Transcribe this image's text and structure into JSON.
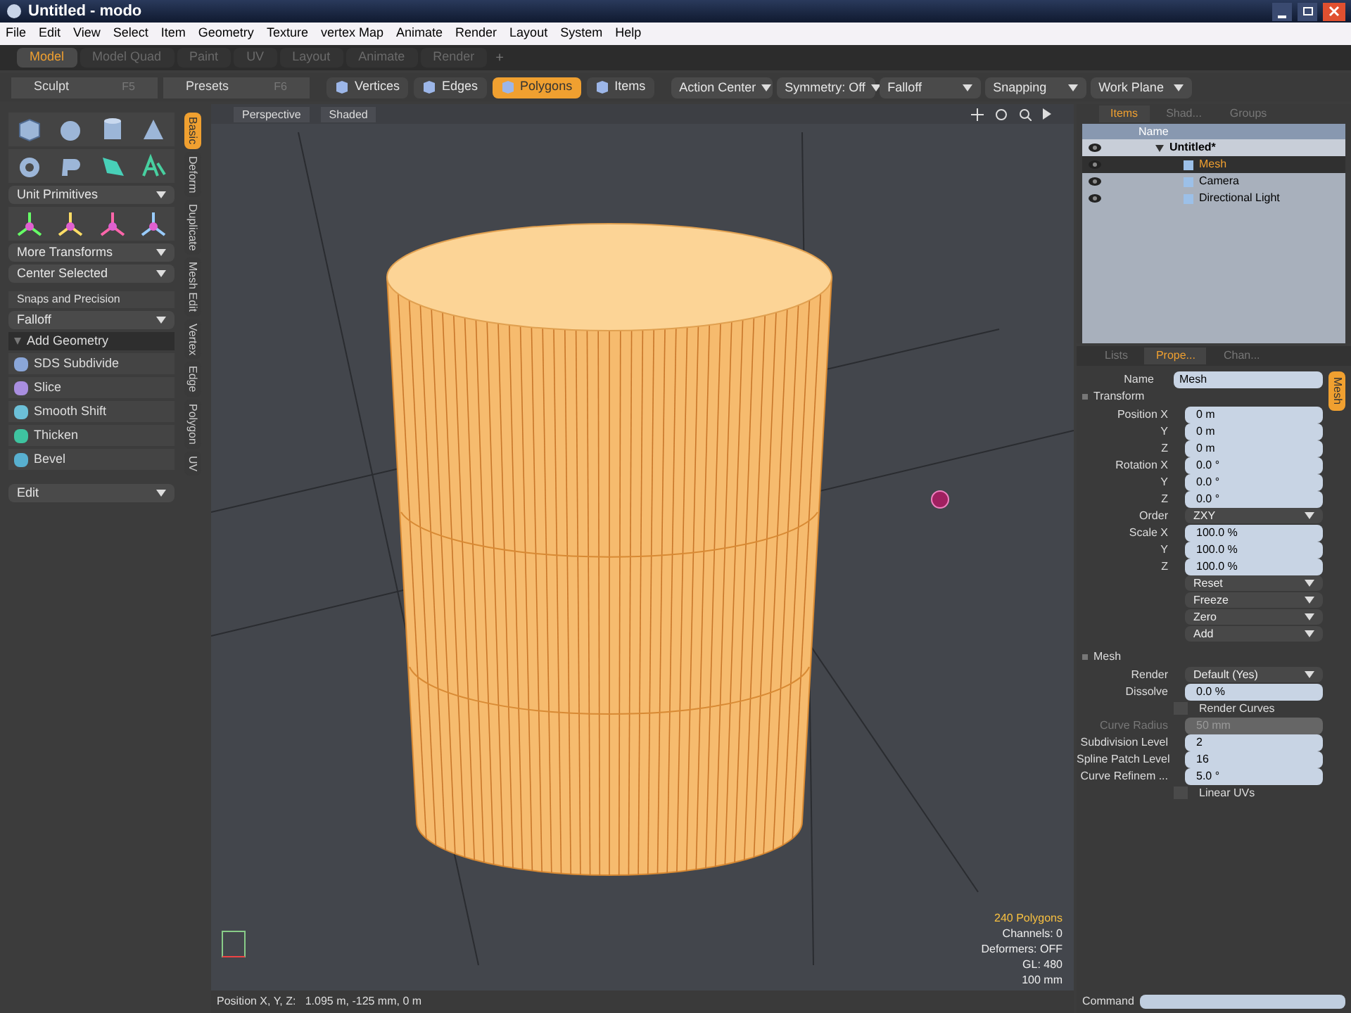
{
  "window": {
    "title": "Untitled - modo"
  },
  "menu": [
    "File",
    "Edit",
    "View",
    "Select",
    "Item",
    "Geometry",
    "Texture",
    "vertex Map",
    "Animate",
    "Render",
    "Layout",
    "System",
    "Help"
  ],
  "layout_tabs": [
    {
      "label": "Model",
      "selected": true
    },
    {
      "label": "Model Quad",
      "selected": false
    },
    {
      "label": "Paint",
      "selected": false
    },
    {
      "label": "UV",
      "selected": false
    },
    {
      "label": "Layout",
      "selected": false
    },
    {
      "label": "Animate",
      "selected": false
    },
    {
      "label": "Render",
      "selected": false
    }
  ],
  "layout_add": "+",
  "left_header": [
    {
      "label": "Sculpt",
      "shortcut": "F5"
    },
    {
      "label": "Presets",
      "shortcut": "F6"
    }
  ],
  "selection_modes": [
    {
      "label": "Vertices",
      "selected": false
    },
    {
      "label": "Edges",
      "selected": false
    },
    {
      "label": "Polygons",
      "selected": true
    },
    {
      "label": "Items",
      "selected": false
    }
  ],
  "toolbar_dropdowns": [
    "Action Center",
    "Symmetry: Off",
    "Falloff",
    "Snapping",
    "Work Plane"
  ],
  "toolbox": {
    "primitives_dropdown": "Unit Primitives",
    "transform_dropdowns": [
      "More Transforms",
      "Center Selected"
    ],
    "snaps_header": "Snaps and Precision",
    "falloff_dropdown": "Falloff",
    "add_geometry": {
      "label": "Add Geometry",
      "expanded": true
    },
    "tools": [
      {
        "label": "SDS Subdivide",
        "color": "#8aa6d8"
      },
      {
        "label": "Slice",
        "color": "#a98ee0"
      },
      {
        "label": "Smooth Shift",
        "color": "#6cc0d8"
      },
      {
        "label": "Thicken",
        "color": "#3ec4a0"
      },
      {
        "label": "Bevel",
        "color": "#58b0d0"
      }
    ],
    "edit_dropdown": "Edit"
  },
  "side_tabs": [
    {
      "label": "Basic",
      "selected": true
    },
    {
      "label": "Deform",
      "selected": false
    },
    {
      "label": "Duplicate",
      "selected": false
    },
    {
      "label": "Mesh Edit",
      "selected": false
    },
    {
      "label": "Vertex",
      "selected": false
    },
    {
      "label": "Edge",
      "selected": false
    },
    {
      "label": "Polygon",
      "selected": false
    },
    {
      "label": "UV",
      "selected": false
    }
  ],
  "viewport": {
    "tabs": [
      "Perspective",
      "Shaded"
    ],
    "stats": [
      {
        "text": "240 Polygons",
        "highlight": true
      },
      {
        "text": "Channels: 0",
        "highlight": false
      },
      {
        "text": "Deformers: OFF",
        "highlight": false
      },
      {
        "text": "GL: 480",
        "highlight": false
      },
      {
        "text": "100 mm",
        "highlight": false
      }
    ]
  },
  "status_bar": {
    "position": "Position X, Y, Z:   1.095 m, -125 mm, 0 m",
    "command_label": "Command"
  },
  "items_panel": {
    "tabs": [
      {
        "label": "Items",
        "selected": true
      },
      {
        "label": "Shad...",
        "selected": false
      },
      {
        "label": "Groups",
        "selected": false
      }
    ],
    "column": "Name",
    "tree": [
      {
        "label": "Untitled*",
        "expanded": true,
        "selected": false,
        "children": [
          {
            "label": "Mesh",
            "selected": true
          },
          {
            "label": "Camera",
            "selected": false
          },
          {
            "label": "Directional Light",
            "selected": false
          }
        ]
      }
    ]
  },
  "properties_panel": {
    "tabs": [
      {
        "label": "Lists",
        "selected": false
      },
      {
        "label": "Prope...",
        "selected": true
      },
      {
        "label": "Chan...",
        "selected": false
      }
    ],
    "side_tab": "Mesh",
    "name_label": "Name",
    "name_value": "Mesh",
    "sections": [
      {
        "title": "Transform",
        "expanded": true,
        "rows": [
          {
            "kind": "field",
            "label": "Position X",
            "value": "0 m"
          },
          {
            "kind": "field",
            "label": "Y",
            "value": "0 m"
          },
          {
            "kind": "field",
            "label": "Z",
            "value": "0 m"
          },
          {
            "kind": "field",
            "label": "Rotation X",
            "value": "0.0 °"
          },
          {
            "kind": "field",
            "label": "Y",
            "value": "0.0 °"
          },
          {
            "kind": "field",
            "label": "Z",
            "value": "0.0 °"
          },
          {
            "kind": "dropdown",
            "label": "Order",
            "value": "ZXY"
          },
          {
            "kind": "field",
            "label": "Scale X",
            "value": "100.0 %"
          },
          {
            "kind": "field",
            "label": "Y",
            "value": "100.0 %"
          },
          {
            "kind": "field",
            "label": "Z",
            "value": "100.0 %"
          },
          {
            "kind": "dropdown",
            "value": "Reset"
          },
          {
            "kind": "dropdown",
            "value": "Freeze"
          },
          {
            "kind": "dropdown",
            "value": "Zero"
          },
          {
            "kind": "dropdown",
            "value": "Add"
          }
        ]
      },
      {
        "title": "Mesh",
        "expanded": true,
        "rows": [
          {
            "kind": "dropdown",
            "label": "Render",
            "value": "Default (Yes)"
          },
          {
            "kind": "slider",
            "label": "Dissolve",
            "value": "0.0 %"
          },
          {
            "kind": "checkbox",
            "label": "Render Curves",
            "checked": false
          },
          {
            "kind": "field",
            "label": "Curve Radius",
            "value": "50 mm",
            "disabled": true
          },
          {
            "kind": "field",
            "label": "Subdivision Level",
            "value": "2"
          },
          {
            "kind": "field",
            "label": "Spline Patch Level",
            "value": "16"
          },
          {
            "kind": "field",
            "label": "Curve Refinem ...",
            "value": "5.0 °"
          },
          {
            "kind": "checkbox",
            "label": "Linear UVs",
            "checked": false
          }
        ]
      }
    ]
  }
}
